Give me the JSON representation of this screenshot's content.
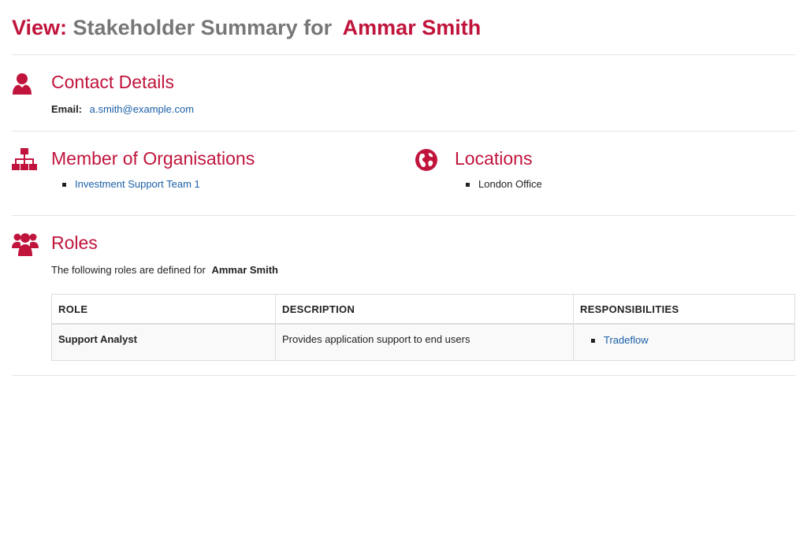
{
  "header": {
    "view_label": "View:",
    "title_text": "Stakeholder Summary for",
    "stakeholder_name": "Ammar Smith"
  },
  "contact": {
    "heading": "Contact Details",
    "email_label": "Email:",
    "email_value": "a.smith@example.com"
  },
  "organisations": {
    "heading": "Member of Organisations",
    "items": [
      "Investment Support Team 1"
    ]
  },
  "locations": {
    "heading": "Locations",
    "items": [
      "London Office"
    ]
  },
  "roles": {
    "heading": "Roles",
    "intro": "The following roles are defined for",
    "intro_name": "Ammar Smith",
    "columns": [
      "ROLE",
      "DESCRIPTION",
      "RESPONSIBILITIES"
    ],
    "rows": [
      {
        "role": "Support Analyst",
        "description": "Provides application support to end users",
        "responsibilities": [
          "Tradeflow"
        ]
      }
    ]
  },
  "colors": {
    "accent": "#c0143c",
    "link": "#1a5fa8",
    "title_grey": "#777777"
  },
  "icons": {
    "contact": "user-icon",
    "organisations": "sitemap-icon",
    "locations": "globe-icon",
    "roles": "users-group-icon"
  }
}
